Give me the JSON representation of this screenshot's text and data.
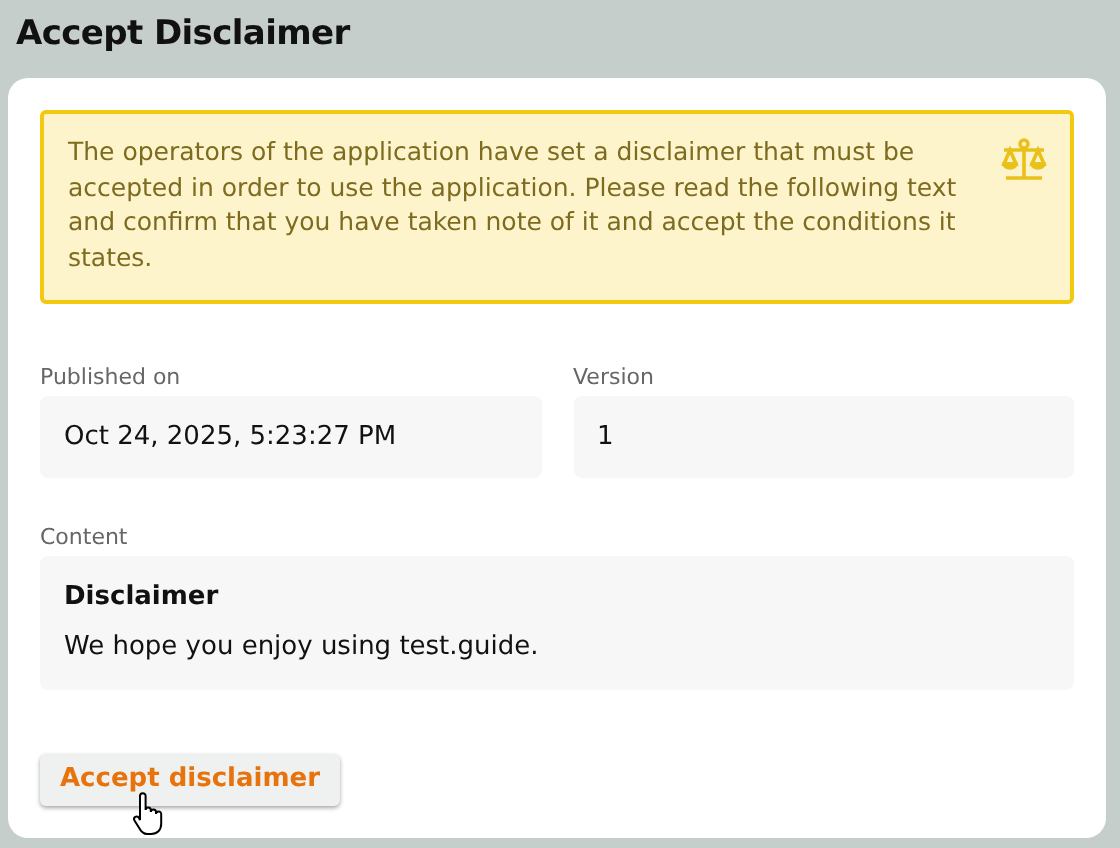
{
  "title": "Accept Disclaimer",
  "notice": {
    "text": "The operators of the application have set a disclaimer that must be accepted in order to use the application. Please read the following text and confirm that you have taken note of it and accept the conditions it states."
  },
  "fields": [
    {
      "label": "Published on",
      "value": "Oct 24, 2025, 5:23:27 PM"
    },
    {
      "label": "Version",
      "value": "1"
    }
  ],
  "content": {
    "label": "Content",
    "heading": "Disclaimer",
    "body": "We hope you enjoy using test.guide."
  },
  "button": {
    "label": "Accept disclaimer"
  }
}
